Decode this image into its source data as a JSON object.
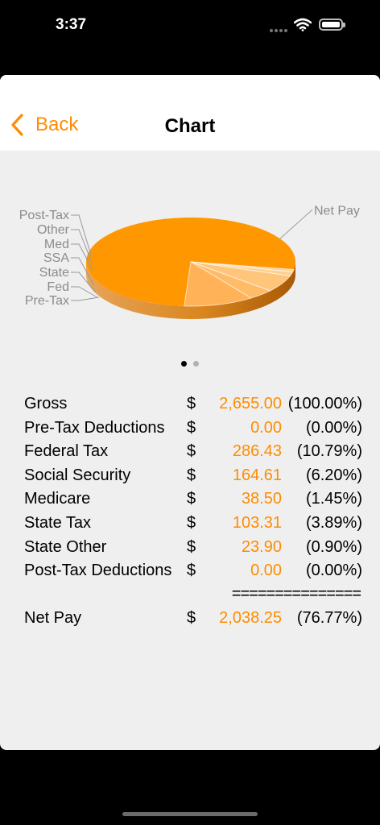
{
  "status": {
    "time": "3:37"
  },
  "nav": {
    "back_label": "Back",
    "title": "Chart"
  },
  "colors": {
    "accent": "#ff8c00",
    "pie_main": "#ff9800",
    "page_dot_active": "#000000",
    "page_dot_inactive": "#b0b0b0"
  },
  "pager": {
    "pages": 2,
    "current": 1
  },
  "chart_data": {
    "type": "pie",
    "labels": [
      "Net Pay",
      "Post-Tax",
      "Other",
      "Med",
      "SSA",
      "State",
      "Fed",
      "Pre-Tax"
    ],
    "values": [
      2038.25,
      0.0,
      23.9,
      38.5,
      164.61,
      103.31,
      286.43,
      0.0
    ]
  },
  "rows": [
    {
      "label": "Gross",
      "dollar": "$",
      "amount": "2,655.00",
      "pct": "(100.00%)"
    },
    {
      "label": "Pre-Tax Deductions",
      "dollar": "$",
      "amount": "0.00",
      "pct": "(0.00%)"
    },
    {
      "label": "Federal Tax",
      "dollar": "$",
      "amount": "286.43",
      "pct": "(10.79%)"
    },
    {
      "label": "Social Security",
      "dollar": "$",
      "amount": "164.61",
      "pct": "(6.20%)"
    },
    {
      "label": "Medicare",
      "dollar": "$",
      "amount": "38.50",
      "pct": "(1.45%)"
    },
    {
      "label": "State Tax",
      "dollar": "$",
      "amount": "103.31",
      "pct": "(3.89%)"
    },
    {
      "label": "State Other",
      "dollar": "$",
      "amount": "23.90",
      "pct": "(0.90%)"
    },
    {
      "label": "Post-Tax Deductions",
      "dollar": "$",
      "amount": "0.00",
      "pct": "(0.00%)"
    }
  ],
  "separator": "===============",
  "total": {
    "label": "Net Pay",
    "dollar": "$",
    "amount": "2,038.25",
    "pct": "(76.77%)"
  }
}
